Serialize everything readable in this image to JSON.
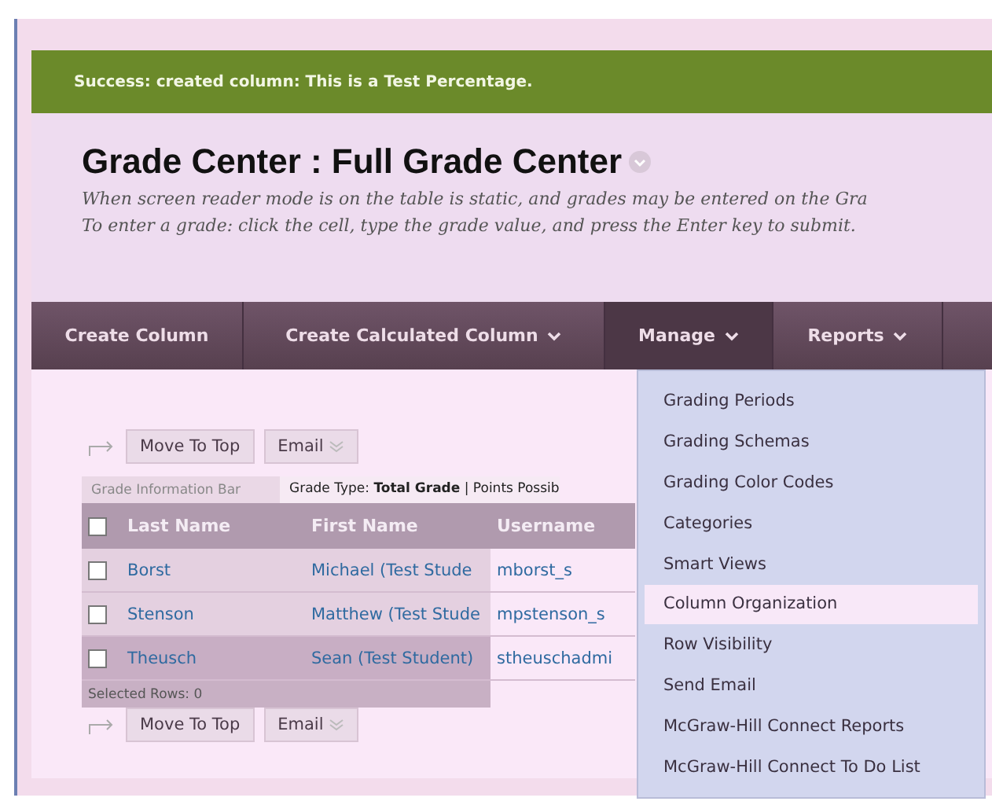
{
  "banner": {
    "message": "Success: created column: This is a Test Percentage."
  },
  "page": {
    "title": "Grade Center : Full Grade Center",
    "instructions": [
      "When screen reader mode is on the table is static, and grades may be entered on the Gra",
      "To enter a grade: click the cell, type the grade value, and press the Enter key to submit."
    ]
  },
  "action_bar": [
    {
      "label": "Create Column",
      "has_menu": false,
      "expanded": false
    },
    {
      "label": "Create Calculated Column",
      "has_menu": true,
      "expanded": false
    },
    {
      "label": "Manage",
      "has_menu": true,
      "expanded": true
    },
    {
      "label": "Reports",
      "has_menu": true,
      "expanded": false
    }
  ],
  "manage_menu": [
    {
      "label": "Grading Periods",
      "selected": false
    },
    {
      "label": "Grading Schemas",
      "selected": false
    },
    {
      "label": "Grading Color Codes",
      "selected": false
    },
    {
      "label": "Categories",
      "selected": false
    },
    {
      "label": "Smart Views",
      "selected": false
    },
    {
      "label": "Column Organization",
      "selected": true
    },
    {
      "label": "Row Visibility",
      "selected": false
    },
    {
      "label": "Send Email",
      "selected": false
    },
    {
      "label": "McGraw-Hill Connect Reports",
      "selected": false
    },
    {
      "label": "McGraw-Hill Connect To Do List",
      "selected": false
    }
  ],
  "top_buttons": [
    "Move To Top",
    "Email"
  ],
  "bottom_buttons": [
    "Move To Top",
    "Email"
  ],
  "info_bar": {
    "label": "Grade Information Bar",
    "text": "Grade Type: **Total Grade** | Points Possib"
  },
  "table": {
    "select_all_checked": false,
    "columns": [
      "Last Name",
      "First Name",
      "Username"
    ],
    "rows": [
      {
        "checked": false,
        "highlighted": false,
        "cells": [
          "Borst",
          "Michael (Test Stude",
          "mborst_s"
        ]
      },
      {
        "checked": false,
        "highlighted": false,
        "cells": [
          "Stenson",
          "Matthew (Test Stude",
          "mpstenson_s"
        ]
      },
      {
        "checked": false,
        "highlighted": true,
        "cells": [
          "Theusch",
          "Sean (Test Student)",
          "stheuschadmi"
        ]
      }
    ],
    "selected_rows": "Selected Rows: 0"
  }
}
